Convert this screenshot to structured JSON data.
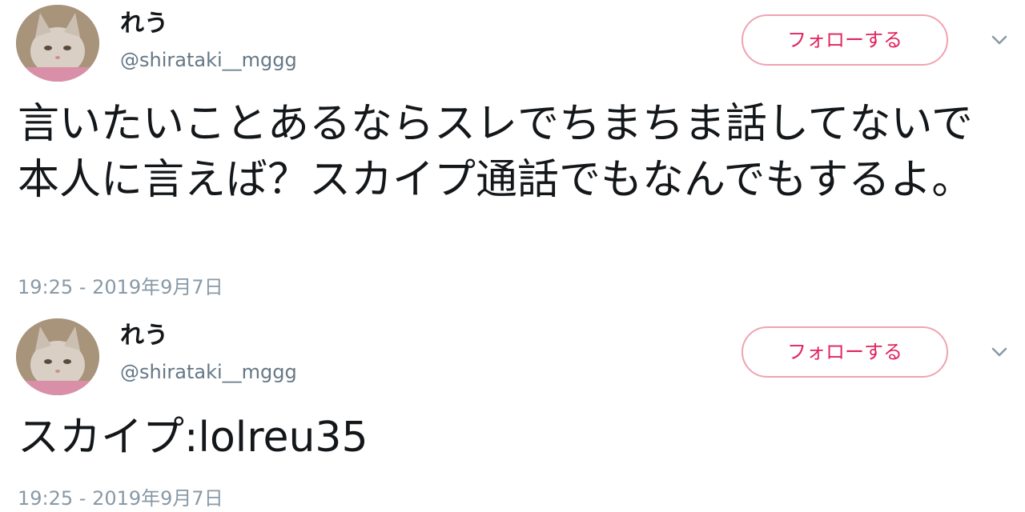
{
  "tweets": [
    {
      "display_name": "れう",
      "handle": "@shirataki__mggg",
      "follow_label": "フォローする",
      "text": "言いたいことあるならスレでちまちま話してないで本人に言えば？スカイプ通話でもなんでもするよ。",
      "timestamp": "19:25 - 2019年9月7日",
      "icons": {
        "menu": "chevron-down-icon",
        "avatar": "cat-avatar"
      }
    },
    {
      "display_name": "れう",
      "handle": "@shirataki__mggg",
      "follow_label": "フォローする",
      "text": "スカイプ:lolreu35",
      "timestamp": "19:25 - 2019年9月7日",
      "icons": {
        "menu": "chevron-down-icon",
        "avatar": "cat-avatar"
      }
    }
  ],
  "colors": {
    "follow_text": "#e0245e",
    "follow_border": "#f0a3b2",
    "secondary_text": "#657786",
    "timestamp_text": "#8899a6",
    "primary_text": "#14171a"
  }
}
